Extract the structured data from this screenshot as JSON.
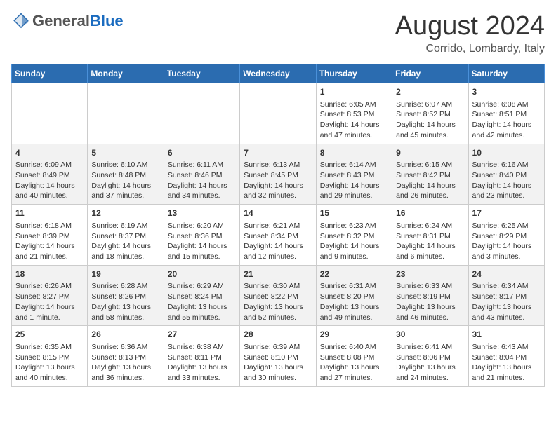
{
  "header": {
    "logo_general": "General",
    "logo_blue": "Blue",
    "month": "August 2024",
    "location": "Corrido, Lombardy, Italy"
  },
  "days_of_week": [
    "Sunday",
    "Monday",
    "Tuesday",
    "Wednesday",
    "Thursday",
    "Friday",
    "Saturday"
  ],
  "weeks": [
    [
      {
        "day": "",
        "content": ""
      },
      {
        "day": "",
        "content": ""
      },
      {
        "day": "",
        "content": ""
      },
      {
        "day": "",
        "content": ""
      },
      {
        "day": "1",
        "content": "Sunrise: 6:05 AM\nSunset: 8:53 PM\nDaylight: 14 hours and 47 minutes."
      },
      {
        "day": "2",
        "content": "Sunrise: 6:07 AM\nSunset: 8:52 PM\nDaylight: 14 hours and 45 minutes."
      },
      {
        "day": "3",
        "content": "Sunrise: 6:08 AM\nSunset: 8:51 PM\nDaylight: 14 hours and 42 minutes."
      }
    ],
    [
      {
        "day": "4",
        "content": "Sunrise: 6:09 AM\nSunset: 8:49 PM\nDaylight: 14 hours and 40 minutes."
      },
      {
        "day": "5",
        "content": "Sunrise: 6:10 AM\nSunset: 8:48 PM\nDaylight: 14 hours and 37 minutes."
      },
      {
        "day": "6",
        "content": "Sunrise: 6:11 AM\nSunset: 8:46 PM\nDaylight: 14 hours and 34 minutes."
      },
      {
        "day": "7",
        "content": "Sunrise: 6:13 AM\nSunset: 8:45 PM\nDaylight: 14 hours and 32 minutes."
      },
      {
        "day": "8",
        "content": "Sunrise: 6:14 AM\nSunset: 8:43 PM\nDaylight: 14 hours and 29 minutes."
      },
      {
        "day": "9",
        "content": "Sunrise: 6:15 AM\nSunset: 8:42 PM\nDaylight: 14 hours and 26 minutes."
      },
      {
        "day": "10",
        "content": "Sunrise: 6:16 AM\nSunset: 8:40 PM\nDaylight: 14 hours and 23 minutes."
      }
    ],
    [
      {
        "day": "11",
        "content": "Sunrise: 6:18 AM\nSunset: 8:39 PM\nDaylight: 14 hours and 21 minutes."
      },
      {
        "day": "12",
        "content": "Sunrise: 6:19 AM\nSunset: 8:37 PM\nDaylight: 14 hours and 18 minutes."
      },
      {
        "day": "13",
        "content": "Sunrise: 6:20 AM\nSunset: 8:36 PM\nDaylight: 14 hours and 15 minutes."
      },
      {
        "day": "14",
        "content": "Sunrise: 6:21 AM\nSunset: 8:34 PM\nDaylight: 14 hours and 12 minutes."
      },
      {
        "day": "15",
        "content": "Sunrise: 6:23 AM\nSunset: 8:32 PM\nDaylight: 14 hours and 9 minutes."
      },
      {
        "day": "16",
        "content": "Sunrise: 6:24 AM\nSunset: 8:31 PM\nDaylight: 14 hours and 6 minutes."
      },
      {
        "day": "17",
        "content": "Sunrise: 6:25 AM\nSunset: 8:29 PM\nDaylight: 14 hours and 3 minutes."
      }
    ],
    [
      {
        "day": "18",
        "content": "Sunrise: 6:26 AM\nSunset: 8:27 PM\nDaylight: 14 hours and 1 minute."
      },
      {
        "day": "19",
        "content": "Sunrise: 6:28 AM\nSunset: 8:26 PM\nDaylight: 13 hours and 58 minutes."
      },
      {
        "day": "20",
        "content": "Sunrise: 6:29 AM\nSunset: 8:24 PM\nDaylight: 13 hours and 55 minutes."
      },
      {
        "day": "21",
        "content": "Sunrise: 6:30 AM\nSunset: 8:22 PM\nDaylight: 13 hours and 52 minutes."
      },
      {
        "day": "22",
        "content": "Sunrise: 6:31 AM\nSunset: 8:20 PM\nDaylight: 13 hours and 49 minutes."
      },
      {
        "day": "23",
        "content": "Sunrise: 6:33 AM\nSunset: 8:19 PM\nDaylight: 13 hours and 46 minutes."
      },
      {
        "day": "24",
        "content": "Sunrise: 6:34 AM\nSunset: 8:17 PM\nDaylight: 13 hours and 43 minutes."
      }
    ],
    [
      {
        "day": "25",
        "content": "Sunrise: 6:35 AM\nSunset: 8:15 PM\nDaylight: 13 hours and 40 minutes."
      },
      {
        "day": "26",
        "content": "Sunrise: 6:36 AM\nSunset: 8:13 PM\nDaylight: 13 hours and 36 minutes."
      },
      {
        "day": "27",
        "content": "Sunrise: 6:38 AM\nSunset: 8:11 PM\nDaylight: 13 hours and 33 minutes."
      },
      {
        "day": "28",
        "content": "Sunrise: 6:39 AM\nSunset: 8:10 PM\nDaylight: 13 hours and 30 minutes."
      },
      {
        "day": "29",
        "content": "Sunrise: 6:40 AM\nSunset: 8:08 PM\nDaylight: 13 hours and 27 minutes."
      },
      {
        "day": "30",
        "content": "Sunrise: 6:41 AM\nSunset: 8:06 PM\nDaylight: 13 hours and 24 minutes."
      },
      {
        "day": "31",
        "content": "Sunrise: 6:43 AM\nSunset: 8:04 PM\nDaylight: 13 hours and 21 minutes."
      }
    ]
  ]
}
